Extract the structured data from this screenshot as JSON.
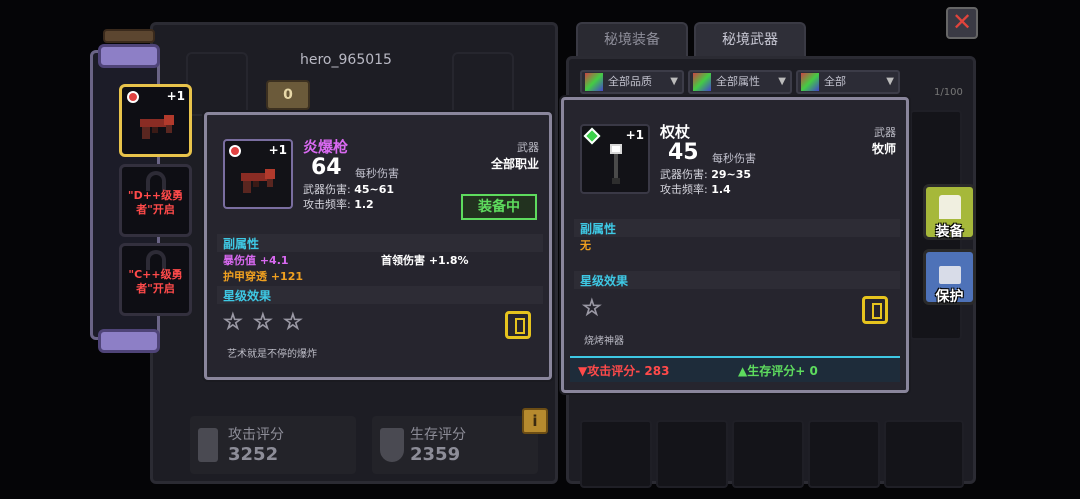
{
  "window": {
    "close_label": "✕"
  },
  "hero": {
    "name": "hero_965015",
    "level": "0"
  },
  "slots": [
    {
      "plus": "+1",
      "locked": false
    },
    {
      "lock_text": "\"D++级勇者\"开启"
    },
    {
      "lock_text": "\"C++级勇者\"开启"
    }
  ],
  "scores": {
    "attack": {
      "label": "攻击评分",
      "value": "3252"
    },
    "survive": {
      "label": "生存评分",
      "value": "2359"
    }
  },
  "info_label": "i",
  "tabs": [
    {
      "label": "秘境装备"
    },
    {
      "label": "秘境武器"
    }
  ],
  "filters": [
    {
      "label": "全部品质"
    },
    {
      "label": "全部属性"
    },
    {
      "label": "全部"
    }
  ],
  "inventory_count": "1/100",
  "side_buttons": {
    "equip": "装备",
    "protect": "保护"
  },
  "current_item": {
    "name": "炎爆枪",
    "plus": "+1",
    "dps": "64",
    "dps_label": "每秒伤害",
    "damage_label": "武器伤害:",
    "damage": "45~61",
    "rate_label": "攻击频率:",
    "rate": "1.2",
    "type": "武器",
    "class": "全部职业",
    "equipped_label": "装备中",
    "sub_attr_title": "副属性",
    "sub_attrs": [
      {
        "label": "暴伤值 +4.1",
        "color": "#d869f0"
      },
      {
        "label": "护甲穿透 +121",
        "color": "#f0a020"
      }
    ],
    "sub_attr_extra": "首领伤害 +1.8%",
    "star_title": "星级效果",
    "description": "艺术就是不停的爆炸",
    "name_color": "#d869f0"
  },
  "compare_item": {
    "name": "权杖",
    "plus": "+1",
    "dps": "45",
    "dps_label": "每秒伤害",
    "damage_label": "武器伤害:",
    "damage": "29~35",
    "rate_label": "攻击频率:",
    "rate": "1.4",
    "type": "武器",
    "class": "牧师",
    "sub_attr_title": "副属性",
    "sub_attr_none": "无",
    "star_title": "星级效果",
    "description": "烧烤神器",
    "attack_score": "▼攻击评分- 283",
    "survive_score": "▲生存评分+ 0"
  },
  "colors": {
    "accent_cyan": "#3ec8e4",
    "equipped_green": "#5edc5e",
    "negative_red": "#ff4a4a",
    "star_gold": "#e6c41e"
  }
}
